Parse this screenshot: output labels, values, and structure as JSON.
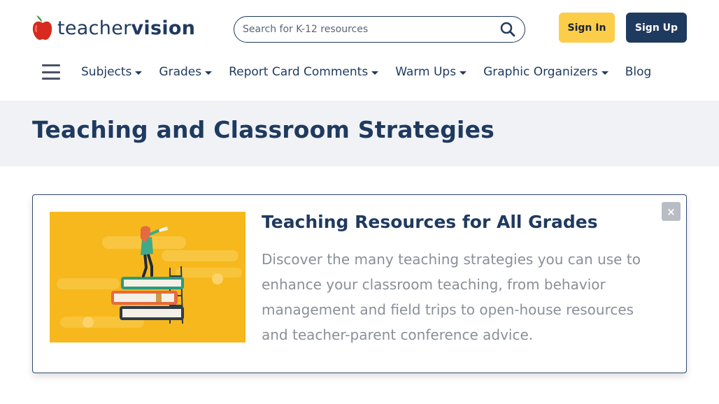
{
  "logo": {
    "text_light": "teacher",
    "text_bold": "vision"
  },
  "search": {
    "placeholder": "Search for K-12 resources",
    "icon": "search-icon"
  },
  "auth": {
    "sign_in": "Sign In",
    "sign_up": "Sign Up"
  },
  "nav": {
    "menu_icon": "hamburger-menu-icon",
    "items": [
      {
        "label": "Subjects",
        "dropdown": true
      },
      {
        "label": "Grades",
        "dropdown": true
      },
      {
        "label": "Report Card Comments",
        "dropdown": true
      },
      {
        "label": "Warm Ups",
        "dropdown": true
      },
      {
        "label": "Graphic Organizers",
        "dropdown": true
      },
      {
        "label": "Blog",
        "dropdown": false
      }
    ]
  },
  "page": {
    "title": "Teaching and Classroom Strategies"
  },
  "card": {
    "title": "Teaching Resources for All Grades",
    "description": "Discover the many teaching strategies you can use to enhance your classroom teaching, from behavior management and field trips to open-house resources and teacher-parent conference advice.",
    "close_label": "×"
  },
  "colors": {
    "brand_navy": "#1f3a5f",
    "sign_in_yellow": "#fbcd49",
    "title_band_bg": "#f0f2f6",
    "illustration_bg": "#f6b81c"
  }
}
